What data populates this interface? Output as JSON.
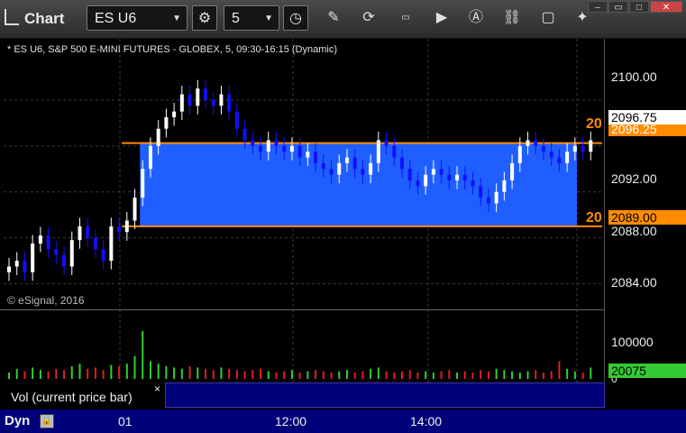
{
  "window": {
    "title": "Chart",
    "symbol": "ES U6",
    "interval": "5"
  },
  "caption": "* ES U6, S&P 500 E-MINI FUTURES - GLOBEX, 5, 09:30-16:15 (Dynamic)",
  "watermark": "© eSignal, 2016",
  "price_axis": {
    "labels": [
      "2100.00",
      "2092.00",
      "2088.00",
      "2084.00"
    ],
    "level_prefix": "20"
  },
  "price_tags": {
    "last": "2096.75",
    "behind_last": "2096.25",
    "lower_level": "2089.00"
  },
  "volume": {
    "panel_label": "Vol (current price bar)",
    "close_symbol": "×",
    "axis_label": "100000",
    "axis_zero": "0",
    "last_value": "20075"
  },
  "time_axis": {
    "labels": [
      "01",
      "12:00",
      "14:00"
    ]
  },
  "status": {
    "mode": "Dyn"
  },
  "colors": {
    "band_fill": "#1f5fff",
    "level_line": "#ff8c00",
    "up_candle": "#ffffff",
    "down_candle": "#1010ff",
    "vol_up": "#2fd12f",
    "vol_down": "#e02020",
    "last_volume_tag": "#33cc33"
  },
  "chart_data": {
    "type": "candlestick",
    "symbol": "ES U6",
    "yrange": [
      2082,
      2104
    ],
    "levels": {
      "upper": 2096.25,
      "lower": 2089.0
    },
    "candles_close": [
      2085.5,
      2086.0,
      2085.0,
      2087.5,
      2088.2,
      2087.0,
      2086.5,
      2085.5,
      2087.8,
      2089.0,
      2088.0,
      2087.0,
      2086.0,
      2089.0,
      2088.5,
      2089.5,
      2091.5,
      2094.0,
      2096.0,
      2097.5,
      2098.5,
      2099.0,
      2100.5,
      2099.5,
      2101.0,
      2100.0,
      2099.5,
      2100.5,
      2099.0,
      2097.5,
      2096.5,
      2096.0,
      2095.5,
      2096.5,
      2096.0,
      2095.5,
      2096.0,
      2095.0,
      2095.5,
      2094.5,
      2094.0,
      2093.5,
      2094.5,
      2095.0,
      2094.0,
      2093.5,
      2094.5,
      2096.5,
      2096.0,
      2095.0,
      2094.0,
      2093.0,
      2092.5,
      2093.5,
      2094.0,
      2093.5,
      2093.0,
      2093.5,
      2093.0,
      2092.5,
      2091.5,
      2091.0,
      2092.0,
      2093.0,
      2094.5,
      2096.0,
      2096.5,
      2096.0,
      2095.5,
      2095.0,
      2094.5,
      2095.5,
      2096.0,
      2095.5,
      2096.5
    ],
    "volumes": [
      5,
      8,
      6,
      9,
      7,
      6,
      8,
      7,
      10,
      12,
      8,
      9,
      7,
      11,
      10,
      12,
      18,
      38,
      14,
      12,
      10,
      9,
      8,
      10,
      9,
      8,
      7,
      9,
      8,
      7,
      6,
      7,
      8,
      6,
      5,
      6,
      7,
      5,
      6,
      7,
      6,
      5,
      6,
      7,
      5,
      6,
      8,
      9,
      6,
      5,
      6,
      7,
      5,
      6,
      5,
      6,
      7,
      5,
      6,
      5,
      7,
      6,
      8,
      7,
      6,
      5,
      6,
      7,
      5,
      6,
      14,
      8,
      6,
      5,
      9
    ]
  }
}
